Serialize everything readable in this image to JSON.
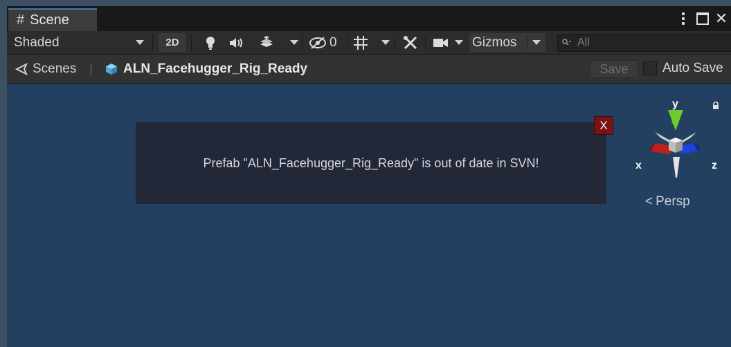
{
  "tab": {
    "icon": "hash-icon",
    "label": "Scene"
  },
  "window_controls": {
    "menu": "kebab-menu-icon",
    "maximize": "maximize-icon",
    "close": "✕"
  },
  "toolbar": {
    "shading_mode": "Shaded",
    "mode_2d": "2D",
    "hidden_count": "0",
    "gizmos_label": "Gizmos",
    "search_placeholder": "All",
    "search_icon_glyph": "🔍"
  },
  "breadcrumb": {
    "scenes_label": "Scenes",
    "prefab_name": "ALN_Facehugger_Rig_Ready",
    "save_label": "Save",
    "auto_save_label": "Auto Save",
    "auto_save_checked": false
  },
  "notification": {
    "message": "Prefab \"ALN_Facehugger_Rig_Ready\" is out of date in SVN!",
    "close_label": "X"
  },
  "orientation_gizmo": {
    "axis_x": "x",
    "axis_y": "y",
    "axis_z": "z",
    "projection_label": "Persp",
    "colors": {
      "x": "#c0201c",
      "y": "#6ccc28",
      "z": "#1c42d6"
    }
  },
  "colors": {
    "viewport_bg": "#234060",
    "notification_bg": "#232838",
    "close_btn": "#7a1414",
    "tab_accent": "#3a79bb"
  }
}
